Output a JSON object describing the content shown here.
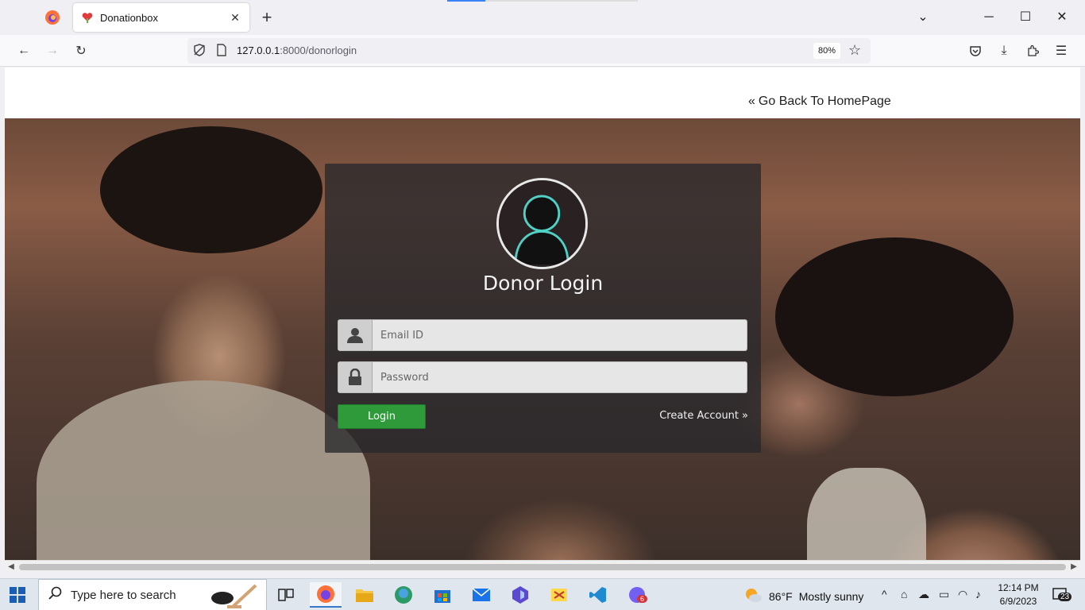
{
  "browser": {
    "tab_title": "Donationbox",
    "url_host": "127.0.0.1",
    "url_rest": ":8000/donorlogin",
    "zoom": "80%"
  },
  "page": {
    "back_link": "Go Back To HomePage",
    "panel_title": "Donor Login",
    "email_placeholder": "Email ID",
    "password_placeholder": "Password",
    "login_button": "Login",
    "create_account": "Create Account"
  },
  "taskbar": {
    "search_placeholder": "Type here to search",
    "weather_temp": "86°F",
    "weather_desc": "Mostly sunny",
    "time": "12:14 PM",
    "date": "6/9/2023",
    "notification_count": "23",
    "badge_count": "6"
  },
  "colors": {
    "login_button": "#2e9a3a",
    "avatar_ring": "#4fd1c5"
  }
}
